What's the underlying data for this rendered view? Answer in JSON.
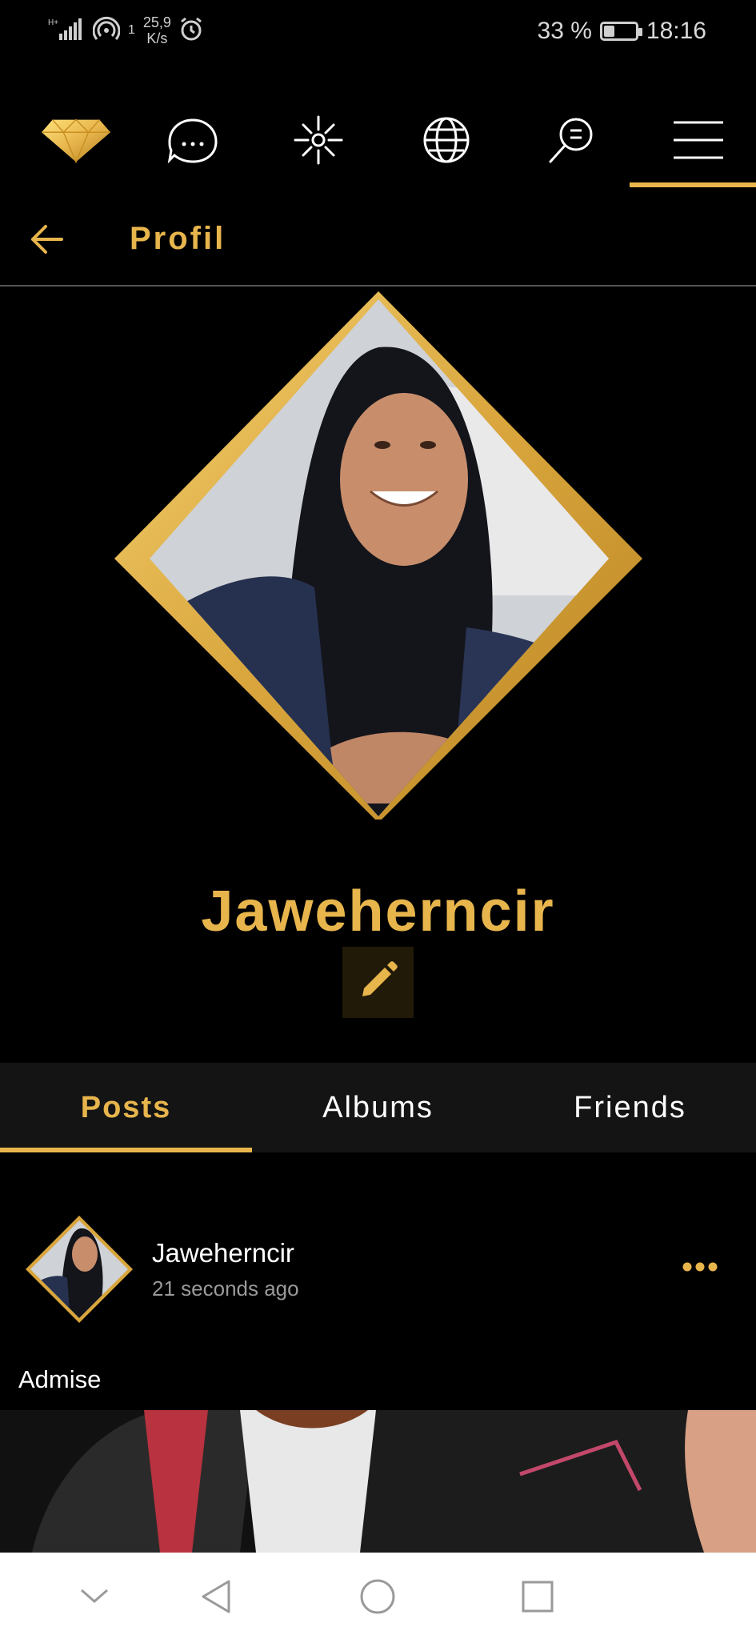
{
  "status_bar": {
    "network_type": "H+",
    "sim_index": "1",
    "speed_value": "25,9",
    "speed_unit": "K/s",
    "battery_percent": "33 %",
    "battery_level": 0.33,
    "time": "18:16"
  },
  "top_nav": {
    "items": [
      {
        "icon": "diamond-icon"
      },
      {
        "icon": "chat-bubble-icon"
      },
      {
        "icon": "sparkle-icon"
      },
      {
        "icon": "globe-icon"
      },
      {
        "icon": "search-icon"
      },
      {
        "icon": "menu-icon"
      }
    ],
    "active_index": 5
  },
  "header": {
    "back_icon": "arrow-left-icon",
    "title": "Profil"
  },
  "profile": {
    "name": "Jaweherncir",
    "edit_icon": "pencil-icon"
  },
  "tabs": [
    {
      "label": "Posts",
      "active": true
    },
    {
      "label": "Albums",
      "active": false
    },
    {
      "label": "Friends",
      "active": false
    }
  ],
  "post": {
    "author": "Jaweherncir",
    "time": "21 seconds ago",
    "text": "Admise",
    "menu_icon": "more-horizontal-icon"
  },
  "system_nav": {
    "items": [
      "chevron-down-icon",
      "back-triangle-icon",
      "home-circle-icon",
      "recents-square-icon"
    ]
  },
  "colors": {
    "accent": "#e7b54c",
    "background": "#000000",
    "tab_bar": "#141414",
    "muted_text": "#9a9a9a"
  }
}
